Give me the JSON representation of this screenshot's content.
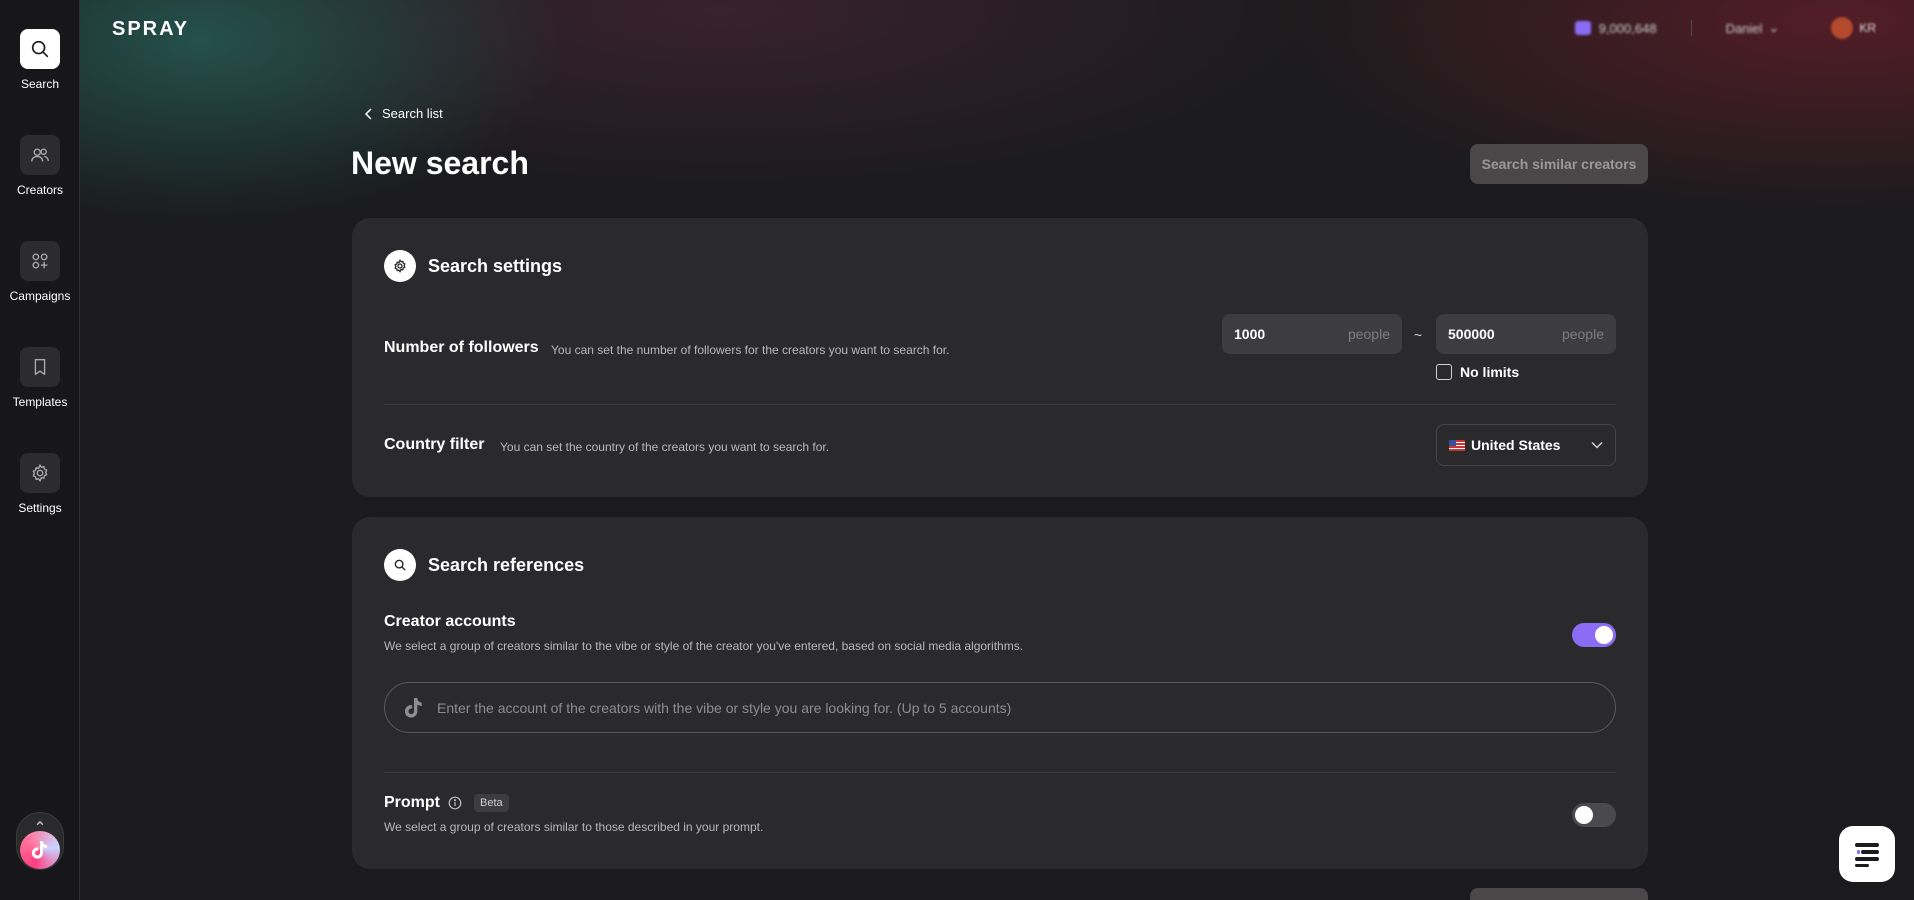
{
  "app": {
    "logo": "SPRAY"
  },
  "sidebar": {
    "items": [
      {
        "label": "Search",
        "icon": "search-icon",
        "active": true
      },
      {
        "label": "Creators",
        "icon": "users-icon",
        "active": false
      },
      {
        "label": "Campaigns",
        "icon": "campaign-grid-icon",
        "active": false
      },
      {
        "label": "Templates",
        "icon": "bookmark-icon",
        "active": false
      },
      {
        "label": "Settings",
        "icon": "gear-icon",
        "active": false
      }
    ],
    "sns_widget": {
      "icon": "tiktok-icon"
    }
  },
  "header": {
    "wallet_balance": "9,000,648",
    "user_name": "Daniel",
    "language": "KR"
  },
  "page": {
    "back_label": "Search list",
    "title": "New search",
    "primary_button": "Search similar creators"
  },
  "search_settings": {
    "title": "Search settings",
    "followers": {
      "label": "Number of followers",
      "description": "You can set the number of followers for the creators you want to search for.",
      "min": "1000",
      "max": "500000",
      "unit": "people",
      "separator": "~",
      "no_limits_label": "No limits",
      "no_limits_checked": false
    },
    "country": {
      "label": "Country filter",
      "description": "You can set the country of the creators you want to search for.",
      "selected": "United States"
    }
  },
  "search_references": {
    "title": "Search references",
    "creator_accounts": {
      "label": "Creator accounts",
      "description": "We select a group of creators similar to the vibe or style of the creator you've entered, based on social media algorithms.",
      "enabled": true,
      "placeholder": "Enter the account of the creators with the vibe or style you are looking for. (Up to 5 accounts)"
    },
    "prompt": {
      "label": "Prompt",
      "badge": "Beta",
      "description": "We select a group of creators similar to those described in your prompt.",
      "enabled": false
    }
  },
  "colors": {
    "accent": "#8b6cf5",
    "card": "#2a2a2c",
    "background": "#1b1b1d"
  }
}
